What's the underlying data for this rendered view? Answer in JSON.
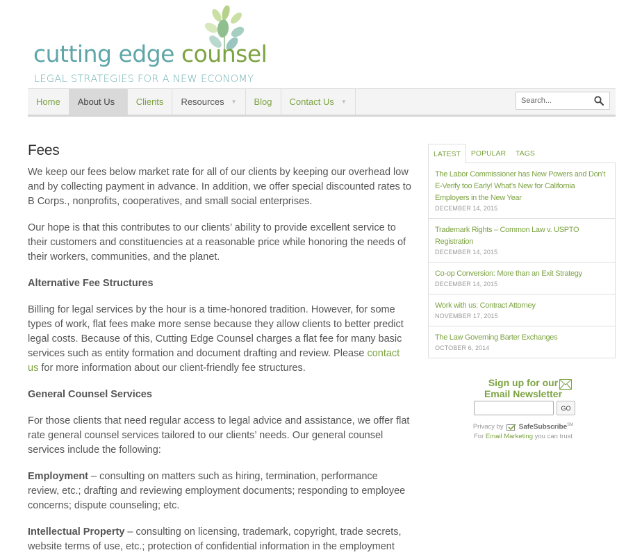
{
  "site": {
    "logo_word1": "cutting edge",
    "logo_word2": "counsel",
    "tagline": "LEGAL STRATEGIES FOR A NEW ECONOMY"
  },
  "nav": {
    "items": [
      {
        "label": "Home"
      },
      {
        "label": "About Us"
      },
      {
        "label": "Clients"
      },
      {
        "label": "Resources"
      },
      {
        "label": "Blog"
      },
      {
        "label": "Contact Us"
      }
    ],
    "search_placeholder": "Search..."
  },
  "main": {
    "title": "Fees",
    "p1": "We keep our fees below market rate for all of our clients by keeping our overhead low and by collecting payment in advance.  In addition, we offer special discounted rates to B Corps., nonprofits, cooperatives, and small social enterprises.",
    "p2": "Our hope is that this contributes to our clients’ ability to provide excellent service to their customers and constituencies at a reasonable price while honoring the needs of their workers, communities, and the planet.",
    "h_alt": "Alternative Fee Structures",
    "p3_before": "Billing for legal services by the hour is a time-honored tradition.  However, for some types of work, flat fees make more sense because they allow clients to better predict legal costs.  Because of this, Cutting Edge Counsel charges a flat fee for many basic services such as entity formation and document drafting and review.  Please ",
    "p3_link": "contact us",
    "p3_after": " for more information about our client-friendly fee structures.",
    "h_gc": "General Counsel Services",
    "p4": "For those clients that need regular access to legal advice and assistance, we offer flat rate general counsel services tailored to our clients’ needs.  Our general counsel services include the following:",
    "emp_lead": "Employment",
    "emp_text": " – consulting on matters such as hiring, termination, performance review, etc.; drafting and reviewing employment documents; responding to employee concerns; dispute counseling; etc.",
    "ip_lead": "Intellectual Property",
    "ip_text": " – consulting on licensing, trademark, copyright, trade secrets, website terms of use, etc.; protection of confidential information in the employment"
  },
  "sidebar": {
    "tabs": [
      "Latest",
      "Popular",
      "Tags"
    ],
    "posts": [
      {
        "title": "The Labor Commissioner has New Powers and Don’t E-Verify too Early! What’s New for California Employers in the New Year",
        "date": "December 14, 2015"
      },
      {
        "title": "Trademark Rights – Common Law v. USPTO Registration",
        "date": "December 14, 2015"
      },
      {
        "title": "Co-op Conversion: More than an Exit Strategy",
        "date": "December 14, 2015"
      },
      {
        "title": "Work with us: Contract Attorney",
        "date": "November 17, 2015"
      },
      {
        "title": "The Law Governing Barter Exchanges",
        "date": "October 6, 2014"
      }
    ]
  },
  "newsletter": {
    "line1": "Sign up for our",
    "line2": "Email Newsletter",
    "go_label": "GO",
    "privacy_by": "Privacy by",
    "brand": "SafeSubscribe",
    "brand_mark": "SM",
    "for_text": "For",
    "for_link": "Email Marketing",
    "for_tail": "you can trust"
  },
  "colors": {
    "accent_green": "#7ca341",
    "logo_teal": "#5fa6a8",
    "text": "#555555"
  }
}
